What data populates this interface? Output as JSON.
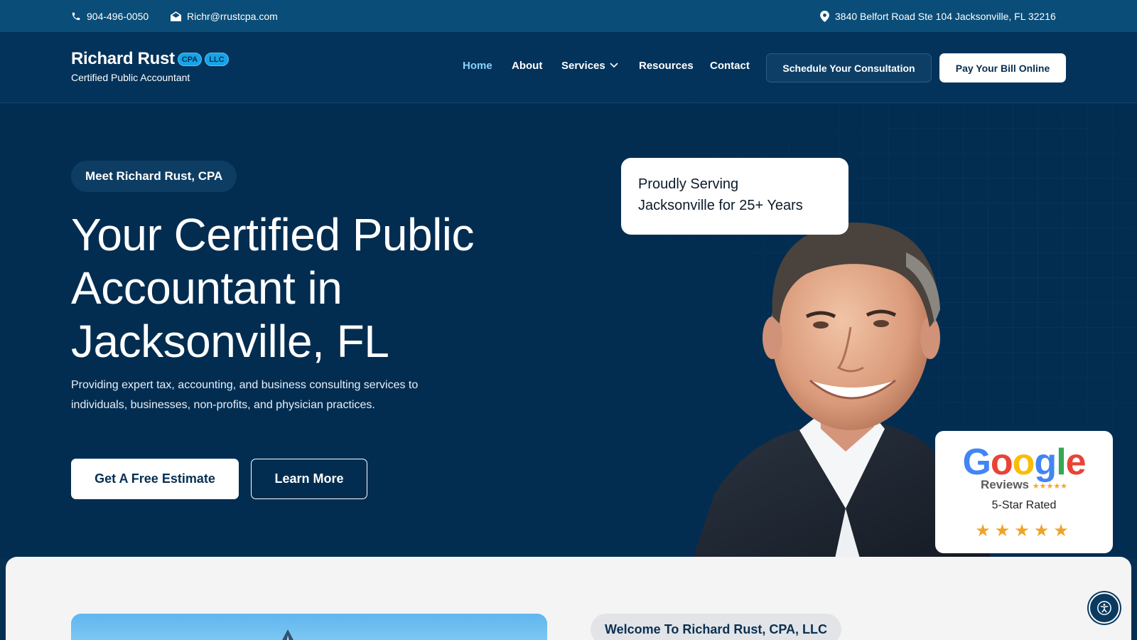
{
  "topbar": {
    "phone": "904-496-0050",
    "email": "Richr@rrustcpa.com",
    "address": "3840 Belfort Road Ste 104 Jacksonville, FL 32216"
  },
  "brand": {
    "name": "Richard Rust",
    "badge_cpa": "CPA",
    "badge_llc": "LLC",
    "tagline": "Certified Public Accountant"
  },
  "nav": {
    "items": [
      {
        "label": "Home",
        "active": true
      },
      {
        "label": "About"
      },
      {
        "label": "Services",
        "has_dropdown": true
      },
      {
        "label": "Resources"
      },
      {
        "label": "Contact"
      }
    ],
    "consult_label": "Schedule Your Consultation",
    "pay_label": "Pay Your Bill Online"
  },
  "hero": {
    "eyebrow": "Meet Richard Rust, CPA",
    "headline_line1": "Your Certified Public",
    "headline_line2": "Accountant in",
    "headline_line3": "Jacksonville, FL",
    "lede": "Providing expert tax, accounting, and business consulting services to individuals, businesses, non-profits, and physician practices.",
    "primary_cta": "Get A Free Estimate",
    "secondary_cta": "Learn More",
    "serving_line1": "Proudly Serving",
    "serving_line2": "Jacksonville for 25+ Years"
  },
  "reviews": {
    "logo_text": "Google",
    "logo_sub": "Reviews",
    "rated": "5-Star Rated",
    "rating": 5,
    "star_color": "#f0a328"
  },
  "welcome": {
    "pill": "Welcome To Richard Rust, CPA, LLC"
  },
  "colors": {
    "topbar": "#0a4d78",
    "hero_bg": "#022d51",
    "accent": "#8ad1ff"
  }
}
